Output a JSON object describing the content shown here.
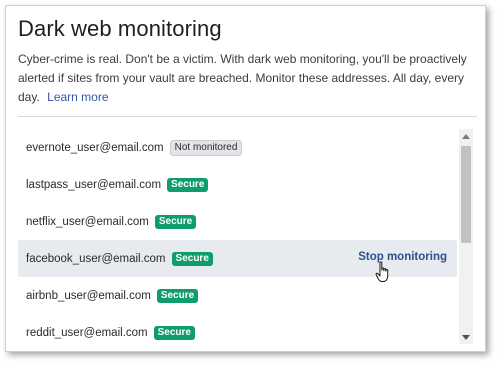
{
  "header": {
    "title": "Dark web monitoring",
    "description": "Cyber-crime is real. Don't be a victim. With dark web monitoring, you'll be proactively alerted if sites from your vault are breached. Monitor these addresses. All day, every day.",
    "learn_more": "Learn more"
  },
  "list": {
    "rows": [
      {
        "email": "evernote_user@email.com",
        "status": "Not monitored"
      },
      {
        "email": "lastpass_user@email.com",
        "status": "Secure"
      },
      {
        "email": "netflix_user@email.com",
        "status": "Secure"
      },
      {
        "email": "facebook_user@email.com",
        "status": "Secure",
        "action": "Stop monitoring"
      },
      {
        "email": "airbnb_user@email.com",
        "status": "Secure"
      },
      {
        "email": "reddit_user@email.com",
        "status": "Secure"
      }
    ]
  },
  "colors": {
    "secure_badge": "#0f9d6c",
    "link": "#3458a3",
    "hover_row": "#e7eaee"
  },
  "icons": {
    "cursor": "hand-pointer-icon",
    "scroll_up": "scroll-up-arrow-icon",
    "scroll_down": "scroll-down-arrow-icon"
  }
}
